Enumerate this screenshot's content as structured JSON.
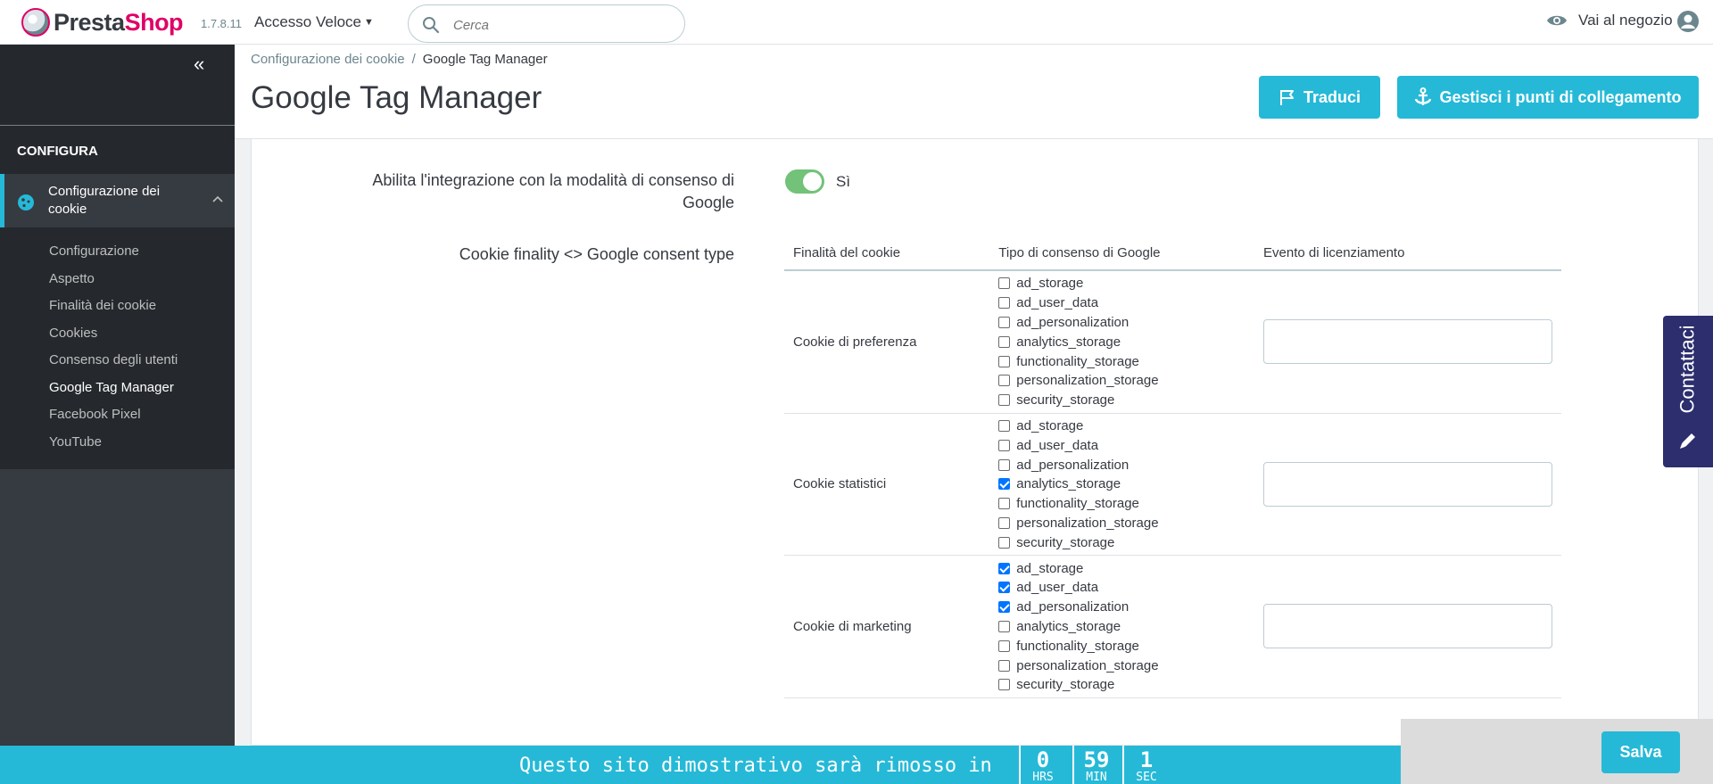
{
  "header": {
    "brand_presta": "Presta",
    "brand_shop": "Shop",
    "version": "1.7.8.11",
    "quick_access": "Accesso Veloce",
    "search_placeholder": "Cerca",
    "visit_shop": "Vai al negozio"
  },
  "sidebar": {
    "section": "CONFIGURA",
    "active_item": "Configurazione dei cookie",
    "items": [
      {
        "label": "Configurazione",
        "current": false
      },
      {
        "label": "Aspetto",
        "current": false
      },
      {
        "label": "Finalità dei cookie",
        "current": false
      },
      {
        "label": "Cookies",
        "current": false
      },
      {
        "label": "Consenso degli utenti",
        "current": false
      },
      {
        "label": "Google Tag Manager",
        "current": true
      },
      {
        "label": "Facebook Pixel",
        "current": false
      },
      {
        "label": "YouTube",
        "current": false
      }
    ]
  },
  "toolbar": {
    "breadcrumb_parent": "Configurazione dei cookie",
    "breadcrumb_sep": "/",
    "breadcrumb_current": "Google Tag Manager",
    "title": "Google Tag Manager",
    "translate_button": "Traduci",
    "hooks_button": "Gestisci i punti di collegamento"
  },
  "form": {
    "consent_label": "Abilita l'integrazione con la modalità di consenso di Google",
    "consent_value": "Sì",
    "consent_enabled": true,
    "finality_label": "Cookie finality <> Google consent type",
    "table": {
      "headers": [
        "Finalità del cookie",
        "Tipo di consenso di Google",
        "Evento di licenziamento"
      ],
      "rows": [
        {
          "finality": "Cookie di preferenza",
          "types": [
            {
              "name": "ad_storage",
              "checked": false
            },
            {
              "name": "ad_user_data",
              "checked": false
            },
            {
              "name": "ad_personalization",
              "checked": false
            },
            {
              "name": "analytics_storage",
              "checked": false
            },
            {
              "name": "functionality_storage",
              "checked": false
            },
            {
              "name": "personalization_storage",
              "checked": false
            },
            {
              "name": "security_storage",
              "checked": false
            }
          ],
          "event": ""
        },
        {
          "finality": "Cookie statistici",
          "types": [
            {
              "name": "ad_storage",
              "checked": false
            },
            {
              "name": "ad_user_data",
              "checked": false
            },
            {
              "name": "ad_personalization",
              "checked": false
            },
            {
              "name": "analytics_storage",
              "checked": true
            },
            {
              "name": "functionality_storage",
              "checked": false
            },
            {
              "name": "personalization_storage",
              "checked": false
            },
            {
              "name": "security_storage",
              "checked": false
            }
          ],
          "event": ""
        },
        {
          "finality": "Cookie di marketing",
          "types": [
            {
              "name": "ad_storage",
              "checked": true
            },
            {
              "name": "ad_user_data",
              "checked": true
            },
            {
              "name": "ad_personalization",
              "checked": true
            },
            {
              "name": "analytics_storage",
              "checked": false
            },
            {
              "name": "functionality_storage",
              "checked": false
            },
            {
              "name": "personalization_storage",
              "checked": false
            },
            {
              "name": "security_storage",
              "checked": false
            }
          ],
          "event": ""
        }
      ]
    }
  },
  "footer": {
    "demo_text": "Questo sito dimostrativo sarà rimosso in",
    "countdown": [
      {
        "value": "0",
        "unit": "HRS"
      },
      {
        "value": "59",
        "unit": "MIN"
      },
      {
        "value": "1",
        "unit": "SEC"
      }
    ],
    "save_button": "Salva"
  },
  "contact_tab": "Contattaci",
  "colors": {
    "accent": "#25b9d7",
    "brand": "#df0067",
    "sidebar_bg": "#363a41",
    "switch_on": "#72c279",
    "contact_bg": "#2c2e6e"
  }
}
